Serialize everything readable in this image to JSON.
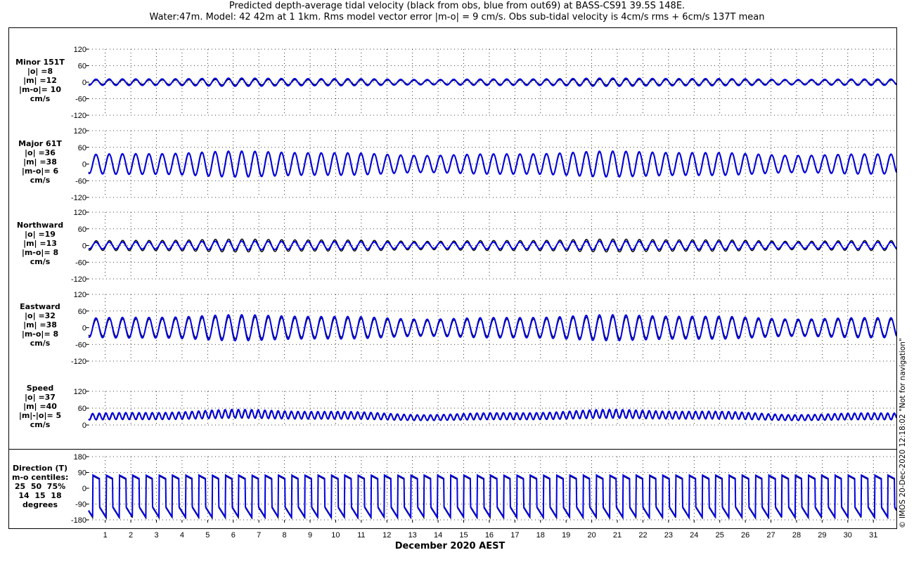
{
  "title_line1": "Predicted depth-average tidal velocity (black from obs, blue from out69) at BASS-CS91 39.5S 148E.",
  "title_line2": "Water:47m. Model: 42 42m at 1 1km. Rms model vector error |m-o| = 9 cm/s. Obs sub-tidal velocity is 4cm/s rms + 6cm/s 137T mean",
  "credit": "© IMOS 20-Dec-2020 12:18:02  \"Not for navigation\"",
  "colors": {
    "obs": "#000000",
    "model": "#0000e6"
  },
  "chart_data": [
    {
      "type": "line",
      "panel": "minor",
      "label_lines": [
        "Minor 151T",
        "|o| =8",
        "|m| =12",
        "|m-o|= 10",
        "cm/s"
      ],
      "ylim": [
        -120,
        120
      ],
      "yticks": [
        "120",
        "60",
        "0",
        "-60",
        "-120"
      ],
      "series": [
        {
          "name": "obs",
          "amplitude": 8,
          "mean": 0
        },
        {
          "name": "model",
          "amplitude": 12,
          "mean": 0
        }
      ]
    },
    {
      "type": "line",
      "panel": "major",
      "label_lines": [
        "Major 61T",
        "|o| =36",
        "|m| =38",
        "|m-o|= 6",
        "cm/s"
      ],
      "ylim": [
        -120,
        120
      ],
      "yticks": [
        "120",
        "60",
        "0",
        "-60",
        "-120"
      ],
      "series": [
        {
          "name": "obs",
          "amplitude": 36,
          "mean": 0
        },
        {
          "name": "model",
          "amplitude": 38,
          "mean": 0
        }
      ]
    },
    {
      "type": "line",
      "panel": "northward",
      "label_lines": [
        "Northward",
        "|o| =19",
        "|m| =13",
        "|m-o|= 8",
        "cm/s"
      ],
      "ylim": [
        -120,
        120
      ],
      "yticks": [
        "120",
        "60",
        "0",
        "-60",
        "-120"
      ],
      "series": [
        {
          "name": "obs",
          "amplitude": 19,
          "mean": 0
        },
        {
          "name": "model",
          "amplitude": 13,
          "mean": 0
        }
      ]
    },
    {
      "type": "line",
      "panel": "eastward",
      "label_lines": [
        "Eastward",
        "|o| =32",
        "|m| =38",
        "|m-o|= 8",
        "cm/s"
      ],
      "ylim": [
        -120,
        120
      ],
      "yticks": [
        "120",
        "60",
        "0",
        "-60",
        "-120"
      ],
      "series": [
        {
          "name": "obs",
          "amplitude": 32,
          "mean": 0
        },
        {
          "name": "model",
          "amplitude": 38,
          "mean": 0
        }
      ]
    },
    {
      "type": "line",
      "panel": "speed",
      "label_lines": [
        "Speed",
        "|o| =37",
        "|m| =40",
        "|m|-|o|= 5",
        "cm/s"
      ],
      "ylim": [
        0,
        120
      ],
      "yticks": [
        "120",
        "60",
        "0"
      ],
      "series": [
        {
          "name": "obs",
          "amplitude": 37,
          "mean": 0
        },
        {
          "name": "model",
          "amplitude": 40,
          "mean": 0
        }
      ]
    },
    {
      "type": "line",
      "panel": "direction",
      "label_lines": [
        "Direction (T)",
        "m-o centiles:",
        "25  50  75%",
        "14  15  18",
        "degrees"
      ],
      "ylim": [
        -180,
        180
      ],
      "yticks": [
        "180",
        "90",
        "0",
        "-90",
        "-180"
      ],
      "series": [
        {
          "name": "obs"
        },
        {
          "name": "model"
        }
      ]
    }
  ],
  "x_axis": {
    "label": "December 2020 AEST",
    "range_days": [
      0.35,
      31.9
    ],
    "ticks": [
      "1",
      "2",
      "3",
      "4",
      "5",
      "6",
      "7",
      "8",
      "9",
      "10",
      "11",
      "12",
      "13",
      "14",
      "15",
      "16",
      "17",
      "18",
      "19",
      "20",
      "21",
      "22",
      "23",
      "24",
      "25",
      "26",
      "27",
      "28",
      "29",
      "30",
      "31"
    ],
    "grid": true
  }
}
